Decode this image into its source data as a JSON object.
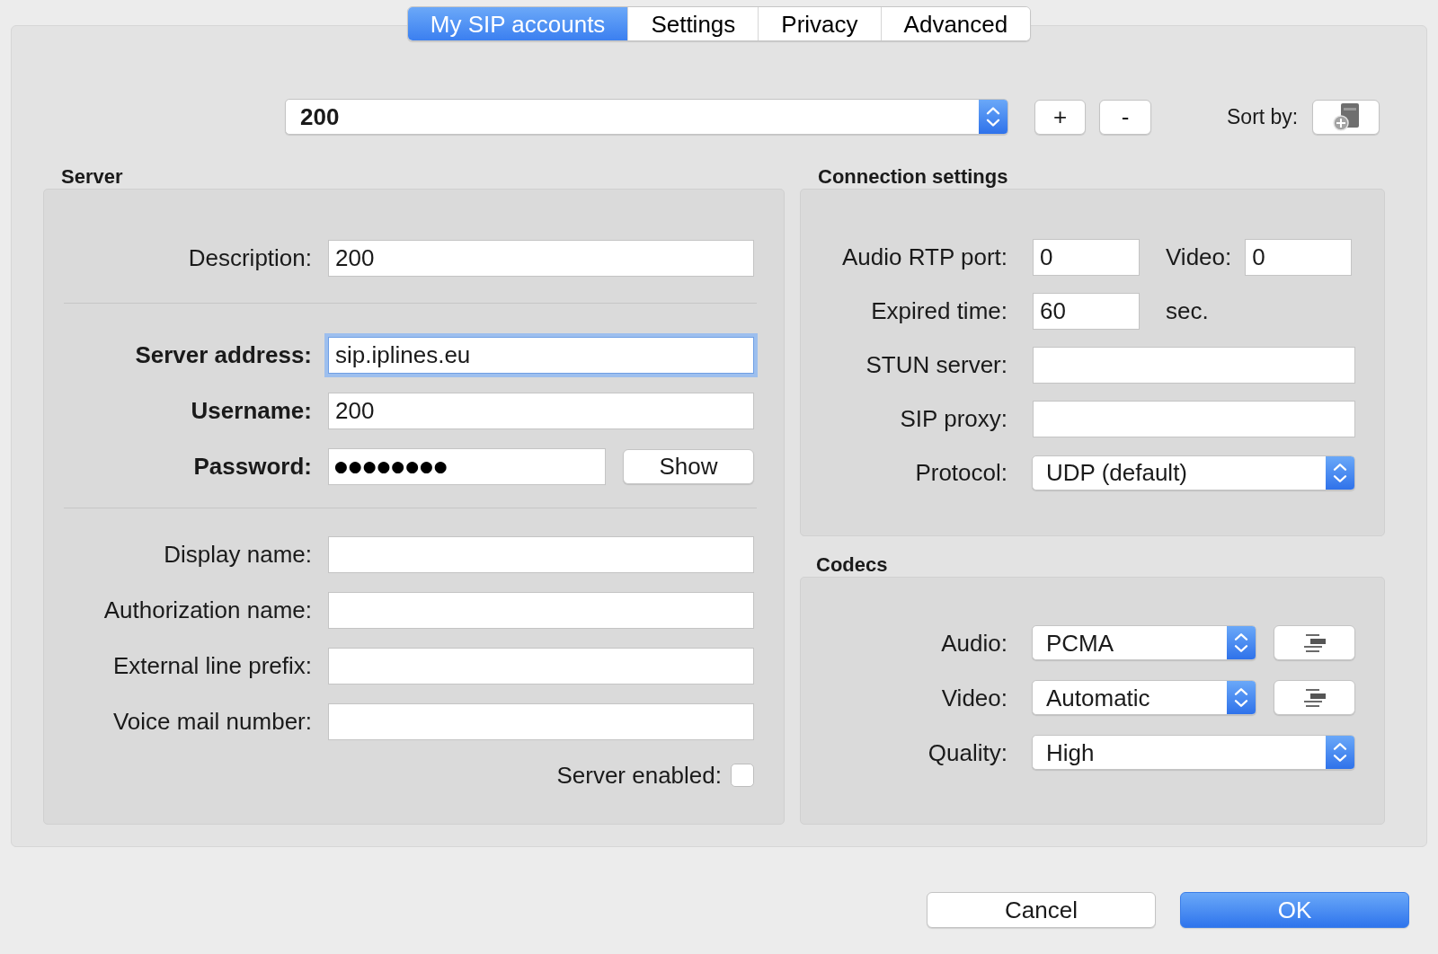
{
  "tabs": [
    {
      "label": "My SIP accounts",
      "selected": true
    },
    {
      "label": "Settings",
      "selected": false
    },
    {
      "label": "Privacy",
      "selected": false
    },
    {
      "label": "Advanced",
      "selected": false
    }
  ],
  "account_bar": {
    "account": "200",
    "add_button": "+",
    "remove_button": "-",
    "sort_label": "Sort by:"
  },
  "server": {
    "title": "Server",
    "sections": [
      {
        "fields": [
          {
            "kind": "text",
            "label": "Description:",
            "value": "200",
            "required": false,
            "focused": false
          }
        ]
      },
      {
        "fields": [
          {
            "kind": "text",
            "label": "Server address:",
            "value": "sip.iplines.eu",
            "required": true,
            "focused": true
          },
          {
            "kind": "text",
            "label": "Username:",
            "value": "200",
            "required": true,
            "focused": false
          },
          {
            "kind": "password",
            "label": "Password:",
            "value": "●●●●●●●●",
            "button": "Show",
            "required": true,
            "focused": false
          }
        ]
      },
      {
        "fields": [
          {
            "kind": "text",
            "label": "Display name:",
            "required": false,
            "focused": false
          },
          {
            "kind": "text",
            "label": "Authorization name:",
            "required": false,
            "focused": false
          },
          {
            "kind": "text",
            "label": "External line prefix:",
            "required": false,
            "focused": false
          },
          {
            "kind": "text",
            "label": "Voice mail number:",
            "required": false,
            "focused": false
          }
        ]
      }
    ],
    "server_enabled": {
      "label": "Server enabled:",
      "checked": false
    }
  },
  "connection": {
    "title": "Connection settings",
    "rows": [
      {
        "kind": "pair",
        "label": "Audio RTP port:",
        "value": "0",
        "second_label": "Video:",
        "second_value": "0"
      },
      {
        "kind": "unit",
        "label": "Expired time:",
        "value": "60",
        "unit": "sec."
      },
      {
        "kind": "text",
        "label": "STUN server:"
      },
      {
        "kind": "text",
        "label": "SIP proxy:"
      },
      {
        "kind": "select",
        "label": "Protocol:",
        "value": "UDP (default)"
      }
    ]
  },
  "codecs": {
    "title": "Codecs",
    "rows": [
      {
        "kind": "select_button",
        "label": "Audio:",
        "value": "PCMA"
      },
      {
        "kind": "select_button",
        "label": "Video:",
        "value": "Automatic"
      },
      {
        "kind": "select",
        "label": "Quality:",
        "value": "High"
      }
    ]
  },
  "buttons": [
    {
      "label": "Cancel",
      "default": false
    },
    {
      "label": "OK",
      "default": true
    }
  ]
}
